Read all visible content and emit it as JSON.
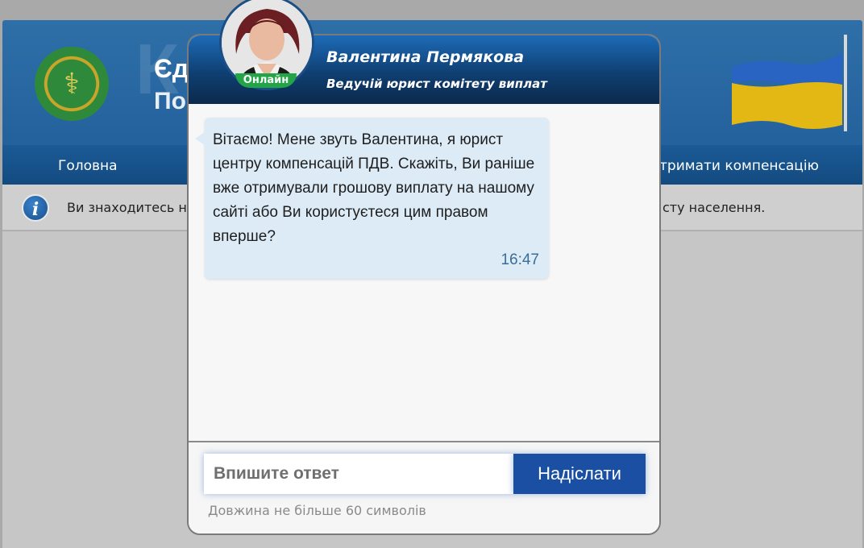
{
  "site": {
    "title": "Єд",
    "subtitle": "По",
    "watermark": "К",
    "nav": {
      "home": "Головна",
      "compensation": "тримати компенсацію"
    },
    "info": {
      "left_text": "Ви знаходитесь н",
      "right_text": "сту населення."
    }
  },
  "chat": {
    "agent_name": "Валентина Пермякова",
    "agent_role": "Ведучій юрист комітету виплат",
    "status": "Онлайн",
    "message": {
      "text": "Вітаємо! Мене звуть Валентина, я юрист центру компенсацій ПДВ. Скажіть, Ви раніше вже отримували грошову виплату на нашому сайті або Ви користуєтеся цим правом вперше?",
      "time": "16:47"
    },
    "input_placeholder": "Впишите ответ",
    "send_label": "Надіслати",
    "hint": "Довжина не більше 60 символів"
  },
  "colors": {
    "header_blue": "#1f5d98",
    "send_button": "#1a4fa3",
    "online_green": "#22a447",
    "bubble_bg": "#dcebf6"
  },
  "icons": {
    "emblem": "caduceus-emblem-icon",
    "info": "info-icon",
    "flag": "ukraine-flag-icon",
    "avatar": "agent-avatar"
  }
}
